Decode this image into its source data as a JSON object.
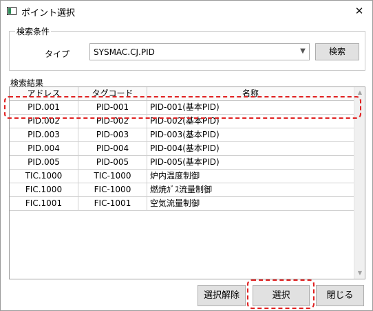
{
  "window": {
    "title": "ポイント選択",
    "close_glyph": "✕"
  },
  "search_conditions": {
    "group_label": "検索条件",
    "type_label": "タイプ",
    "type_value": "SYSMAC.CJ.PID",
    "search_button": "検索"
  },
  "results": {
    "label": "検索結果",
    "columns": [
      "アドレス",
      "タグコード",
      "名称"
    ],
    "rows": [
      {
        "address": "PID.001",
        "tag": "PID-001",
        "name": "PID-001(基本PID)"
      },
      {
        "address": "PID.002",
        "tag": "PID-002",
        "name": "PID-002(基本PID)"
      },
      {
        "address": "PID.003",
        "tag": "PID-003",
        "name": "PID-003(基本PID)"
      },
      {
        "address": "PID.004",
        "tag": "PID-004",
        "name": "PID-004(基本PID)"
      },
      {
        "address": "PID.005",
        "tag": "PID-005",
        "name": "PID-005(基本PID)"
      },
      {
        "address": "TIC.1000",
        "tag": "TIC-1000",
        "name": "炉内温度制御"
      },
      {
        "address": "FIC.1000",
        "tag": "FIC-1000",
        "name": "燃焼ｶﾞｽ流量制御"
      },
      {
        "address": "FIC.1001",
        "tag": "FIC-1001",
        "name": "空気流量制御"
      }
    ]
  },
  "buttons": {
    "deselect": "選択解除",
    "select": "選択",
    "close": "閉じる"
  },
  "colors": {
    "highlight": "#e02020",
    "button_face": "#e1e1e1"
  }
}
